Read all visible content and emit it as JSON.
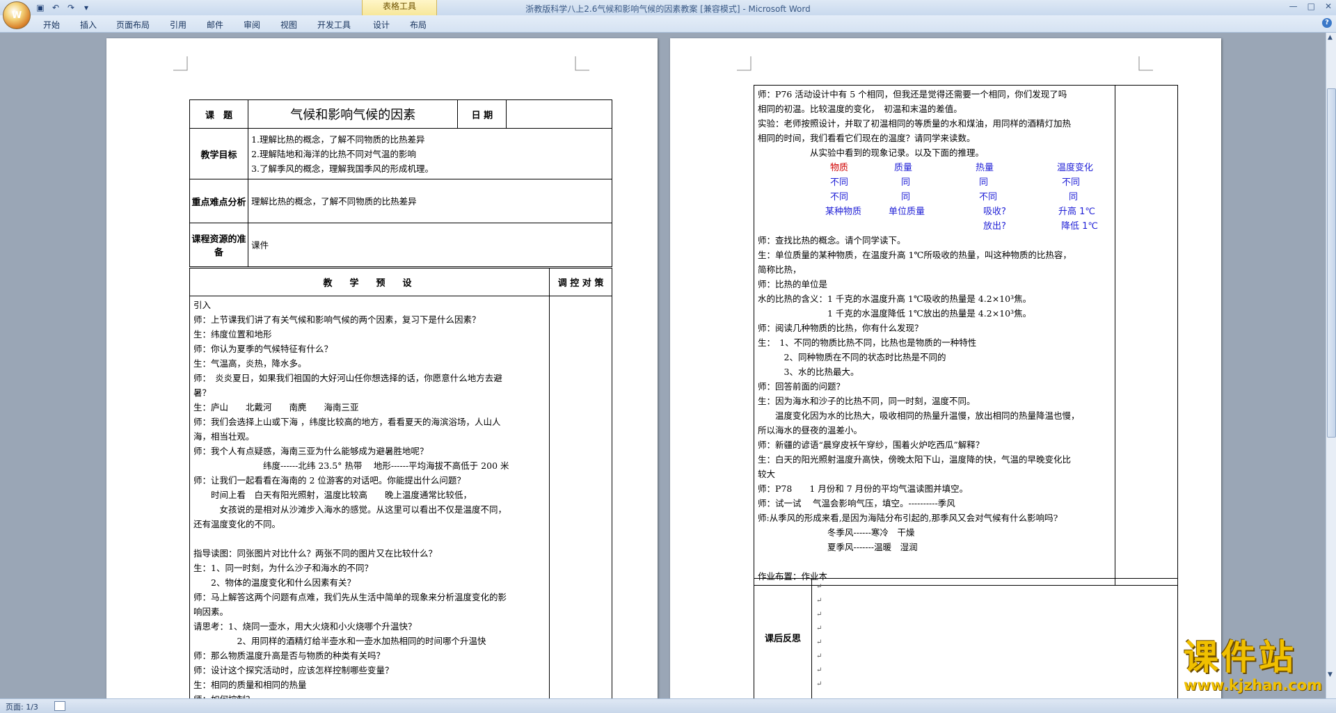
{
  "window": {
    "title": "浙教版科学八上2.6气候和影响气候的因素教案 [兼容模式] - Microsoft Word",
    "context_tab": "表格工具"
  },
  "ribbon": {
    "tabs": [
      "开始",
      "插入",
      "页面布局",
      "引用",
      "邮件",
      "审阅",
      "视图",
      "开发工具",
      "设计",
      "布局"
    ]
  },
  "status": {
    "page": "页面: 1/3"
  },
  "left_page": {
    "topic_label": "课　题",
    "topic_title": "气候和影响气候的因素",
    "date_label": "日 期",
    "goal_label": "教学目标",
    "goals": [
      "1.理解比热的概念，了解不同物质的比热差异",
      "2.理解陆地和海洋的比热不同对气温的影响",
      "3.了解季风的概念，理解我国季风的形成机理。"
    ],
    "keypoint_label": "重点难点分析",
    "keypoint_text": "理解比热的概念，了解不同物质的比热差异",
    "resource_label": "课程资源的准备",
    "resource_text": "课件",
    "preset_label": "教　学　预　设",
    "adjust_label": "调 控 对 策",
    "lines": [
      "引入",
      "师：上节课我们讲了有关气候和影响气候的两个因素，复习下是什么因素？",
      "生：纬度位置和地形",
      "师：你认为夏季的气候特征有什么？",
      "生：气温高，炎热，降水多。",
      "师：　炎炎夏日，如果我们祖国的大好河山任你想选择的话，你愿意什么地方去避",
      "暑？",
      "生：庐山　　北戴河　　南麂　　海南三亚",
      "师：我们会选择上山或下海 ，纬度比较高的地方，看看夏天的海滨浴场，人山人",
      "海，相当壮观。",
      "师：我个人有点疑惑，海南三亚为什么能够成为避暑胜地呢？",
      "　　　　　　　　纬度------北纬 23.5° 热带　 地形------平均海拔不高低于 200 米",
      "师：让我们一起看看在海南的 2 位游客的对话吧。你能提出什么问题？",
      "　　时间上看　白天有阳光照射，温度比较高　　晚上温度通常比较低，",
      "　　　女孩说的是相对从沙滩步入海水的感觉。从这里可以看出不仅是温度不同，",
      "还有温度变化的不同。",
      "",
      "指导读图：同张图片对比什么？两张不同的图片又在比较什么？",
      "生：1、同一时刻，为什么沙子和海水的不同？",
      "　　2、物体的温度变化和什么因素有关？",
      "师：马上解答这两个问题有点难，我们先从生活中简单的现象来分析温度变化的影",
      "响因素。",
      "请思考：1、烧同一壶水，用大火烧和小火烧哪个升温快？",
      "　　　　　2、用同样的酒精灯给半壶水和一壶水加热相同的时间哪个升温快",
      "师：那么物质温度升高是否与物质的种类有关吗？",
      "师：设计这个探究活动时，应该怎样控制哪些变量？",
      "生：相同的质量和相同的热量",
      "师：如何控制？"
    ]
  },
  "right_page": {
    "lines_a": [
      "师：P76 活动设计中有 5 个相同，但我还是觉得还需要一个相同，你们发现了吗",
      "相同的初温。比较温度的变化，　初温和末温的差值。",
      "实验：老师按照设计，并取了初温相同的等质量的水和煤油，用同样的酒精灯加热",
      "相同的时间，我们看看它们现在的温度？请同学来读数。",
      "　　　　　　从实验中看到的现象记录。以及下面的推理。"
    ],
    "grid_header": [
      "物质",
      "质量",
      "热量",
      "温度变化"
    ],
    "grid_rows": [
      [
        "不同",
        "同",
        "同",
        "不同"
      ],
      [
        "不同",
        "同",
        "不同",
        "同"
      ],
      [
        "某种物质",
        "单位质量",
        "吸收?",
        "升高 1℃"
      ],
      [
        "",
        "",
        "放出?",
        "降低 1℃"
      ]
    ],
    "lines_b": [
      "师：查找比热的概念。请个同学读下。",
      "生：单位质量的某种物质，在温度升高 1℃所吸收的热量，叫这种物质的比热容，",
      "简称比热，",
      "师：比热的单位是",
      "水的比热的含义：1 千克的水温度升高 1℃吸收的热量是 4.2×10³焦。",
      "　　　　　　　　1 千克的水温度降低 1℃放出的热量是 4.2×10³焦。",
      "师：阅读几种物质的比热，你有什么发现？",
      "生：　1、不同的物质比热不同，比热也是物质的一种特性",
      "　　　2、同种物质在不同的状态时比热是不同的",
      "　　　3、水的比热最大。",
      "师：回答前面的问题？",
      "生：因为海水和沙子的比热不同，同一时刻，温度不同。",
      "　　温度变化因为水的比热大，吸收相同的热量升温慢，放出相同的热量降温也慢，",
      "所以海水的昼夜的温差小。",
      "师：新疆的谚语“晨穿皮袄午穿纱，围着火炉吃西瓜”解释？",
      "生：白天的阳光照射温度升高快，傍晚太阳下山，温度降的快，气温的早晚变化比",
      "较大",
      "师：P78　　1 月份和 7 月份的平均气温读图并填空。",
      "师：试一试　 气温会影响气压，填空。----------季风",
      "师:从季风的形成来看,是因为海陆分布引起的,那季风又会对气候有什么影响吗?",
      "　　　　　　　　冬季风------寒冷　干燥",
      "　　　　　　　　夏季风-------温暖　湿润",
      "",
      "作业布置：作业本"
    ],
    "reflection_label": "课后反思",
    "reflection_marks": [
      "↵",
      "↵",
      "↵",
      "↵",
      "↵",
      "↵",
      "↵",
      "↵"
    ]
  },
  "watermark": {
    "brand": "课件站",
    "url": "www.kjzhan.com"
  }
}
